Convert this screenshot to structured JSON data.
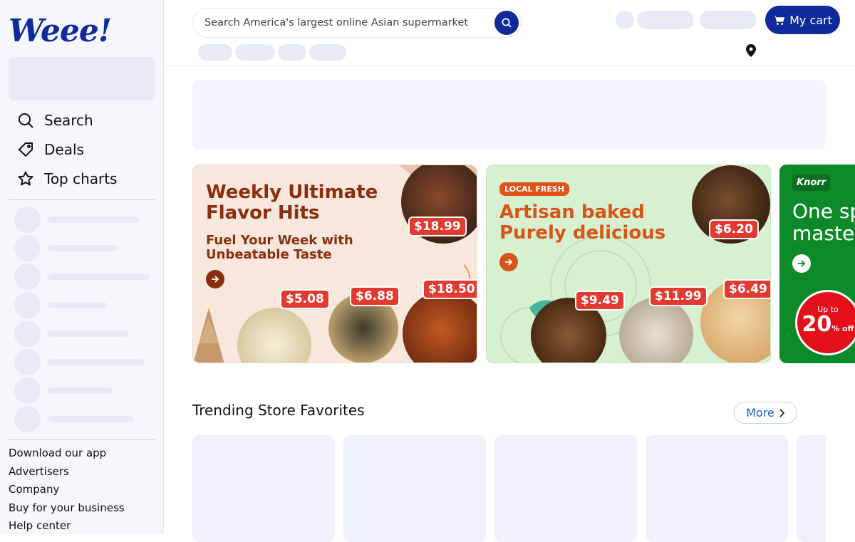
{
  "brand": {
    "logo_text": "Weee!",
    "accent": "#0f2a9a",
    "link_color": "#1a5dc8"
  },
  "sidebar": {
    "nav": [
      {
        "label": "Search",
        "icon": "search-icon"
      },
      {
        "label": "Deals",
        "icon": "tag-icon"
      },
      {
        "label": "Top charts",
        "icon": "star-icon"
      }
    ],
    "footer_links": [
      "Download our app",
      "Advertisers",
      "Company",
      "Buy for your business",
      "Help center"
    ]
  },
  "header": {
    "search_placeholder": "Search America's largest online Asian supermarket",
    "cart_label": "My cart"
  },
  "banners": [
    {
      "title_line1": "Weekly Ultimate",
      "title_line2": "Flavor Hits",
      "subtitle_line1": "Fuel Your Week with",
      "subtitle_line2": "Unbeatable Taste",
      "prices": [
        "$18.99",
        "$5.08",
        "$6.88",
        "$18.50"
      ]
    },
    {
      "badge": "LOCAL FRESH",
      "title_line1": "Artisan baked",
      "title_line2": "Purely delicious",
      "prices": [
        "$6.20",
        "$9.49",
        "$11.99",
        "$6.49"
      ]
    },
    {
      "brand": "Knorr",
      "title_line1": "One sp",
      "title_line2": "maste",
      "promo_top": "Up to",
      "promo_value": "20",
      "promo_unit": "% off"
    }
  ],
  "section": {
    "title": "Trending Store Favorites",
    "more_label": "More"
  }
}
